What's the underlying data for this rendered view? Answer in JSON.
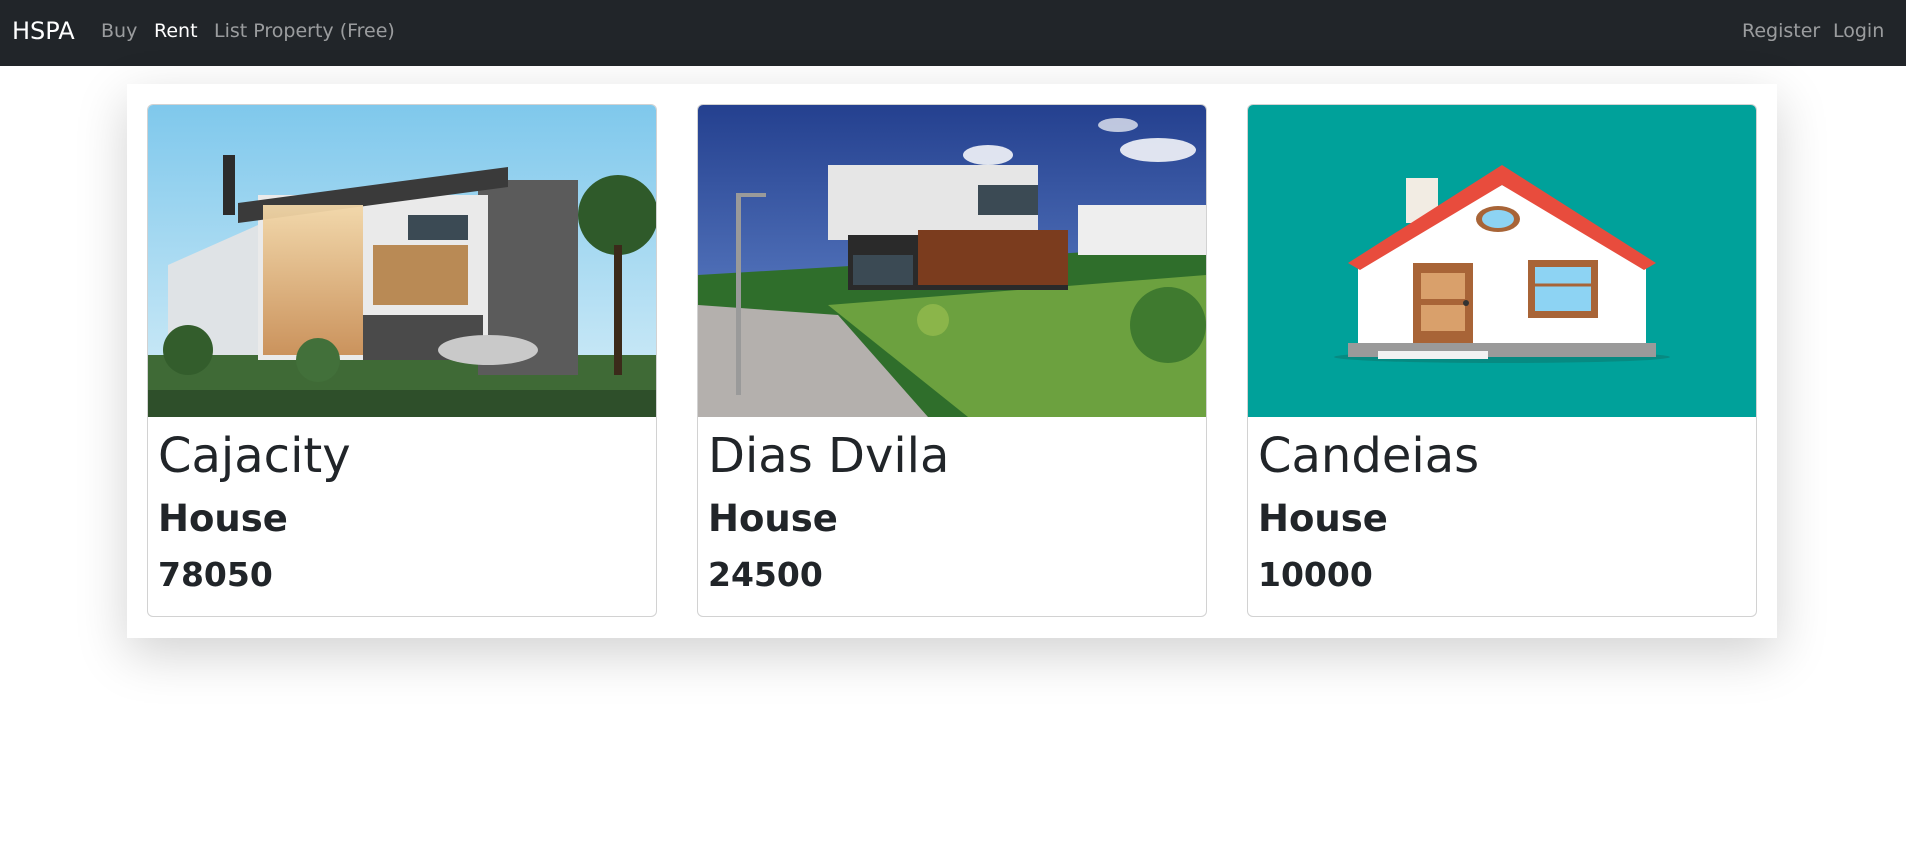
{
  "navbar": {
    "brand": "HSPA",
    "links": [
      {
        "label": "Buy",
        "active": false
      },
      {
        "label": "Rent",
        "active": true
      },
      {
        "label": "List Property (Free)",
        "active": false
      }
    ],
    "right_links": [
      {
        "label": "Register"
      },
      {
        "label": "Login"
      }
    ]
  },
  "properties": [
    {
      "name": "Cajacity",
      "type": "House",
      "price": "78050",
      "image": "modern-glass-house-photo"
    },
    {
      "name": "Dias Dvila",
      "type": "House",
      "price": "24500",
      "image": "hillside-modern-house-photo"
    },
    {
      "name": "Candeias",
      "type": "House",
      "price": "10000",
      "image": "house-illustration-icon"
    }
  ],
  "colors": {
    "navbar_bg": "#212529",
    "illustration_bg": "#00a19a",
    "roof": "#e84c3d"
  }
}
